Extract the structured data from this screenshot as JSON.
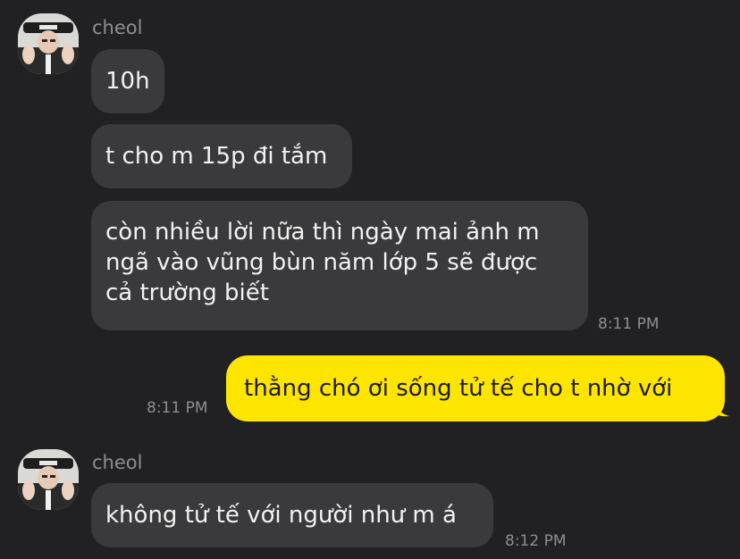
{
  "conversation": {
    "messages": [
      {
        "sender": "cheol",
        "text": "10h"
      },
      {
        "sender": "cheol",
        "text": "t cho m 15p đi tắm"
      },
      {
        "sender": "cheol",
        "lines": [
          "còn nhiều lời nữa thì ngày mai ảnh m",
          "ngã vào vũng bùn năm lớp 5 sẽ được",
          "cả trường biết"
        ],
        "time": "8:11 PM"
      },
      {
        "sender": "me",
        "text": "thằng chó ơi sống tử tế cho t nhờ với",
        "time": "8:11 PM"
      },
      {
        "sender": "cheol",
        "text": "không tử tế với người như m á",
        "time": "8:12 PM"
      }
    ],
    "group1_sender": "cheol",
    "group2_sender": "cheol"
  },
  "colors": {
    "background": "#212123",
    "incoming_bubble": "#3a3a3c",
    "outgoing_bubble": "#fee500",
    "timestamp": "#8e8e93"
  },
  "icons": {
    "avatar": "profile-photo"
  }
}
